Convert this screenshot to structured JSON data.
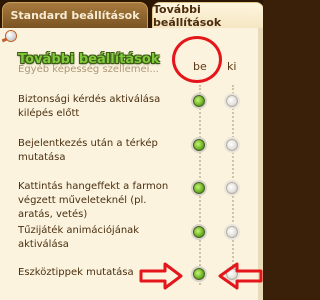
{
  "tabs": [
    {
      "label": "Standard beállítások"
    },
    {
      "label": "További beállítások"
    }
  ],
  "section": {
    "title": "További beállítások",
    "hidden_text": "Egyéb képesség szellemei..."
  },
  "columns": {
    "on": "be",
    "off": "ki"
  },
  "rows": [
    {
      "label": "Biztonsági kérdés aktiválása kilépés előtt",
      "selected": "be"
    },
    {
      "label": "Bejelentkezés után a térkép mutatása",
      "selected": "be"
    },
    {
      "label": "Kattintás hangeffekt a farmon végzett műveleteknél (pl. aratás, vetés)",
      "selected": "be"
    },
    {
      "label": "Tűzijáték animációjának aktiválása",
      "selected": "be"
    },
    {
      "label": "Eszköztippek mutatása",
      "selected": "be"
    }
  ],
  "annotations": {
    "circle_color": "#e5151c",
    "arrow_color": "#e5151c"
  },
  "colors": {
    "accent": "#7fc93a",
    "panel": "#fbf3de",
    "text": "#4a2f10"
  }
}
